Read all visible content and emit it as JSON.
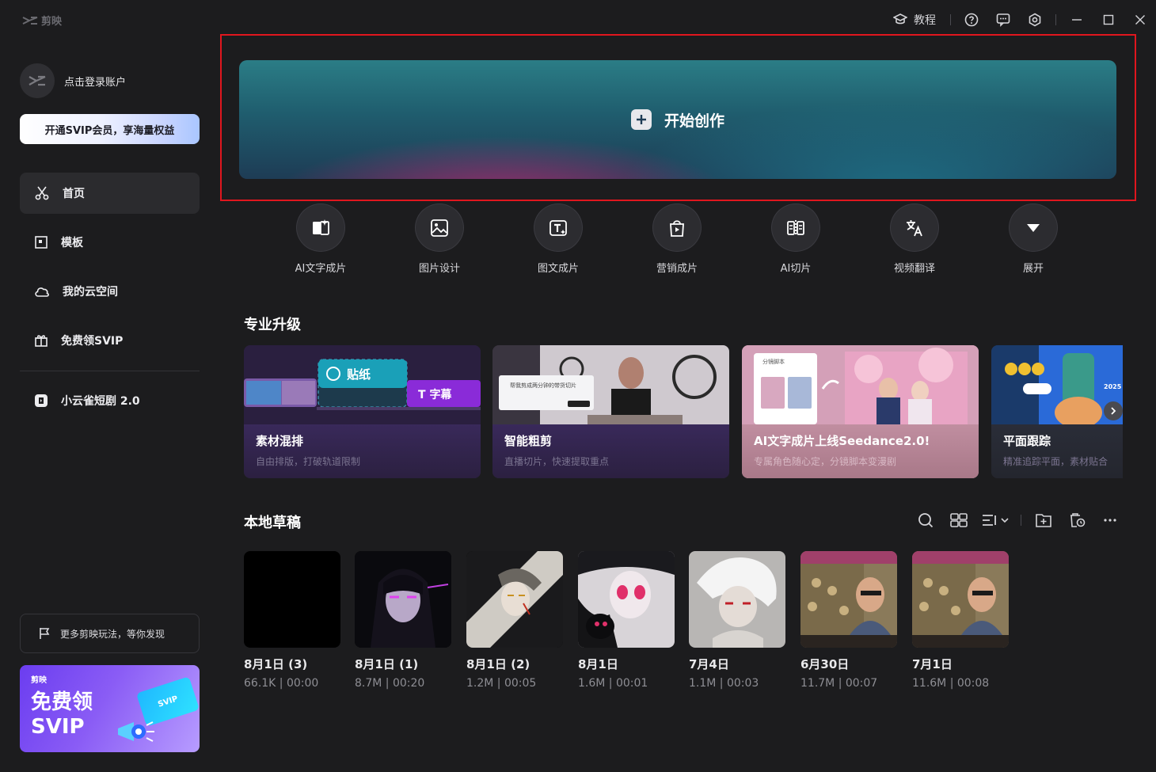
{
  "app": {
    "logo_text": "剪映"
  },
  "titlebar": {
    "tutorial_label": "教程"
  },
  "account": {
    "login_label": "点击登录账户"
  },
  "vip_button": {
    "label": "开通SVIP会员，享海量权益"
  },
  "nav": [
    {
      "label": "首页",
      "icon": "scissors-icon"
    },
    {
      "label": "模板",
      "icon": "template-icon"
    },
    {
      "label": "我的云空间",
      "icon": "cloud-icon"
    },
    {
      "label": "免费领SVIP",
      "icon": "gift-icon"
    }
  ],
  "drama": {
    "label": "小云雀短剧 2.0"
  },
  "more": {
    "label": "更多剪映玩法，等你发现"
  },
  "promo": {
    "brand": "剪映",
    "title": "免费领SVIP",
    "card_text": "SVIP"
  },
  "hero": {
    "label": "开始创作"
  },
  "tools": [
    {
      "label": "AI文字成片",
      "icon": "ai-text-icon"
    },
    {
      "label": "图片设计",
      "icon": "image-design-icon"
    },
    {
      "label": "图文成片",
      "icon": "text-image-icon"
    },
    {
      "label": "营销成片",
      "icon": "shopping-bag-icon"
    },
    {
      "label": "AI切片",
      "icon": "ai-cut-icon"
    },
    {
      "label": "视频翻译",
      "icon": "translate-icon"
    },
    {
      "label": "展开",
      "icon": "expand-icon"
    }
  ],
  "upgrade_section": {
    "title": "专业升级"
  },
  "upgrades": [
    {
      "title": "素材混排",
      "subtitle": "自由排版，打破轨道限制",
      "tag1": "贴纸",
      "tag2": "字幕"
    },
    {
      "title": "智能粗剪",
      "subtitle": "直播切片，快速提取重点",
      "screen_text": "帮我剪成两分钟的带货切片"
    },
    {
      "title": "AI文字成片上线Seedance2.0!",
      "subtitle": "专属角色随心定，分镜脚本变漫剧",
      "doc_label": "分镜脚本"
    },
    {
      "title": "平面跟踪",
      "subtitle": "精准追踪平面，素材贴合",
      "badge": "2025"
    }
  ],
  "drafts_section": {
    "title": "本地草稿"
  },
  "drafts": [
    {
      "name": "8月1日 (3)",
      "meta": "66.1K | 00:00"
    },
    {
      "name": "8月1日 (1)",
      "meta": "8.7M | 00:20"
    },
    {
      "name": "8月1日 (2)",
      "meta": "1.2M | 00:05"
    },
    {
      "name": "8月1日",
      "meta": "1.6M | 00:01"
    },
    {
      "name": "7月4日",
      "meta": "1.1M | 00:03"
    },
    {
      "name": "6月30日",
      "meta": "11.7M | 00:07"
    },
    {
      "name": "7月1日",
      "meta": "11.6M | 00:08"
    }
  ],
  "colors": {
    "background": "#1c1c1e",
    "accent_red": "#e0161e",
    "hero_teal": "#2b7d86",
    "hero_pink": "#d22878"
  }
}
